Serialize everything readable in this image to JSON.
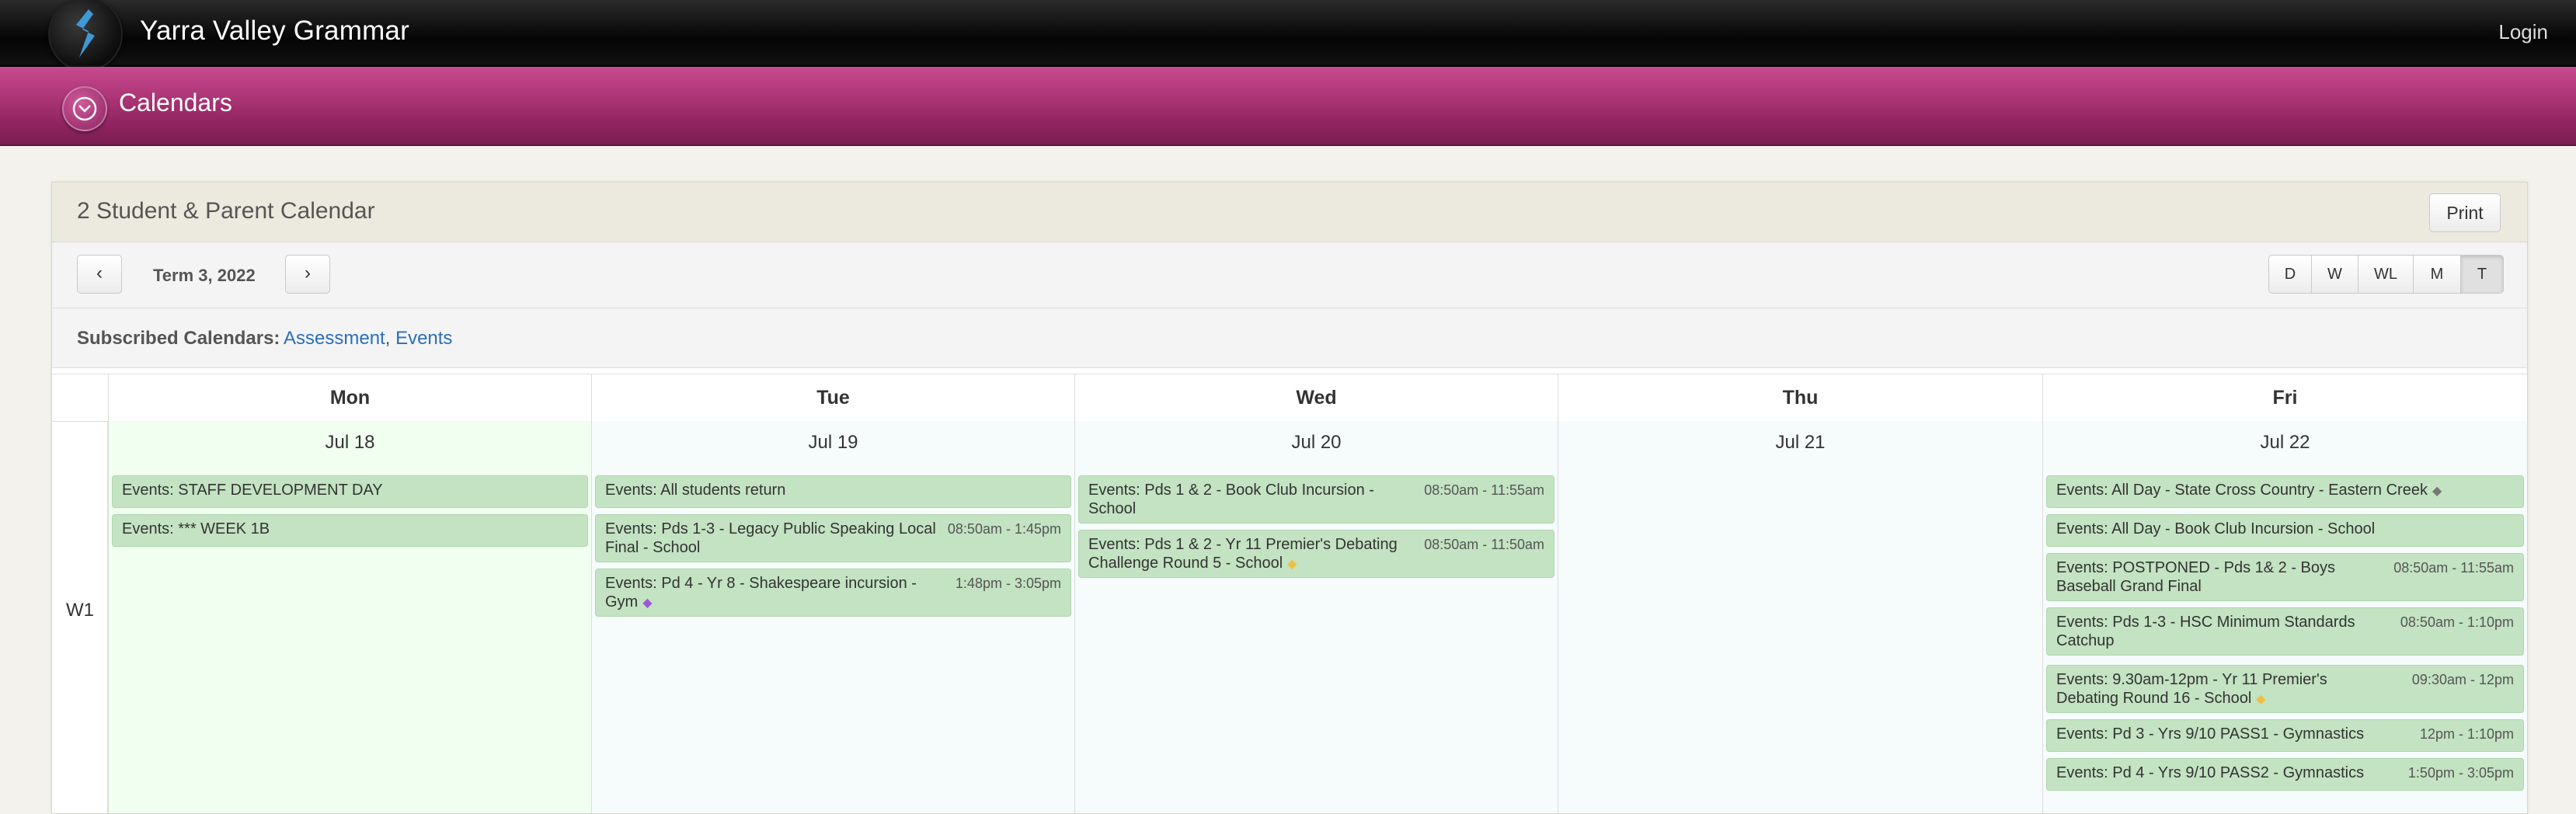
{
  "header": {
    "school_name": "Yarra Valley Grammar",
    "login_label": "Login"
  },
  "subheader": {
    "title": "Calendars"
  },
  "panel": {
    "title": "2 Student & Parent Calendar",
    "print_label": "Print",
    "term_label": "Term 3, 2022",
    "prev_label": "‹",
    "next_label": "›",
    "views": [
      "D",
      "W",
      "WL",
      "M",
      "T"
    ],
    "active_view": "T",
    "subscribed_label": "Subscribed Calendars:",
    "subscribed": [
      "Assessment",
      "Events"
    ]
  },
  "calendar": {
    "week_label": "W1",
    "days": [
      {
        "name": "Mon",
        "date": "Jul 18",
        "events": [
          {
            "text": "Events: STAFF DEVELOPMENT DAY",
            "time": ""
          },
          {
            "text": "Events: *** WEEK 1B",
            "time": ""
          }
        ]
      },
      {
        "name": "Tue",
        "date": "Jul 19",
        "events": [
          {
            "text": "Events: All students return",
            "time": ""
          },
          {
            "text": "Events: Pds 1-3 - Legacy Public Speaking Local Final - School",
            "time": "08:50am - 1:45pm"
          },
          {
            "text": "Events: Pd 4 - Yr 8 - Shakespeare incursion - Gym",
            "time": "1:48pm - 3:05pm",
            "tag": "purple"
          }
        ]
      },
      {
        "name": "Wed",
        "date": "Jul 20",
        "events": [
          {
            "text": "Events: Pds 1 & 2 - Book Club Incursion - School",
            "time": "08:50am - 11:55am"
          },
          {
            "text": "Events: Pds 1 & 2 - Yr 11 Premier's Debating Challenge Round 5 - School",
            "time": "08:50am - 11:50am",
            "tag": "yellow"
          }
        ]
      },
      {
        "name": "Thu",
        "date": "Jul 21",
        "events": []
      },
      {
        "name": "Fri",
        "date": "Jul 22",
        "events": [
          {
            "text": "Events: All Day - State Cross Country - Eastern Creek",
            "time": "",
            "tag": "gray"
          },
          {
            "text": "Events: All Day - Book Club Incursion - School",
            "time": ""
          },
          {
            "text": "Events: POSTPONED - Pds 1& 2 - Boys Baseball Grand Final",
            "time": "08:50am - 11:55am"
          },
          {
            "text": "Events: Pds 1-3 - HSC Minimum Standards Catchup",
            "time": "08:50am - 1:10pm"
          },
          {
            "text": "Events: 9.30am-12pm - Yr 11 Premier's Debating Round 16 - School",
            "time": "09:30am - 12pm",
            "tag": "yellow"
          },
          {
            "text": "Events: Pd 3 - Yrs 9/10 PASS1 - Gymnastics",
            "time": "12pm - 1:10pm"
          },
          {
            "text": "Events: Pd 4 - Yrs 9/10 PASS2 - Gymnastics",
            "time": "1:50pm - 3:05pm"
          }
        ]
      }
    ]
  },
  "colors": {
    "pink": "#b33a7c",
    "event_bg": "#c3e3c2",
    "link": "#2a6fb8",
    "mon_bg": "#f0fff0",
    "day_bg": "#f6fbfc"
  }
}
